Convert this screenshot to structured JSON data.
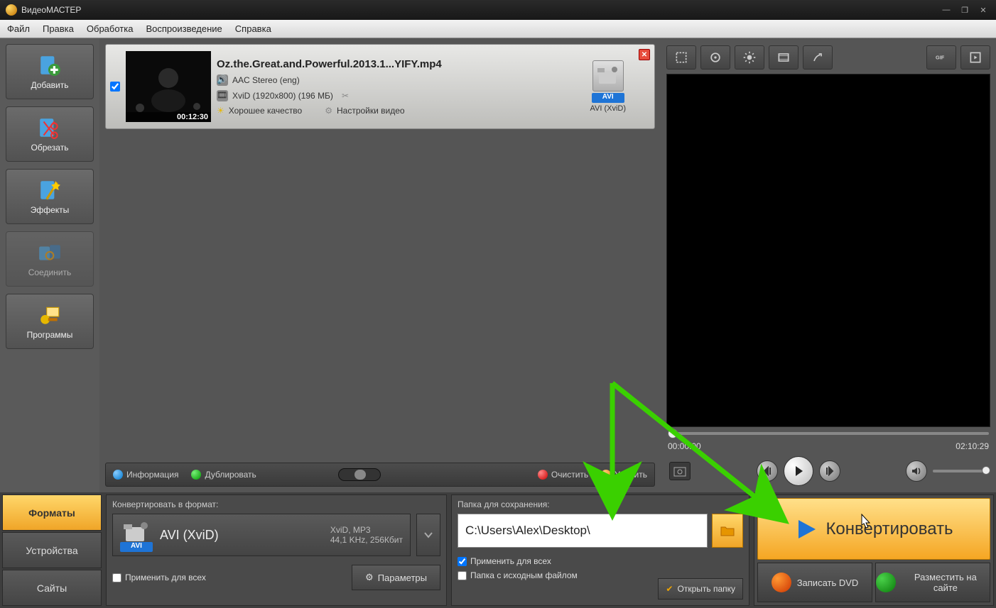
{
  "title": "ВидеоМАСТЕР",
  "menu": [
    "Файл",
    "Правка",
    "Обработка",
    "Воспроизведение",
    "Справка"
  ],
  "sidebar": [
    {
      "label": "Добавить",
      "name": "add-button"
    },
    {
      "label": "Обрезать",
      "name": "cut-button"
    },
    {
      "label": "Эффекты",
      "name": "effects-button"
    },
    {
      "label": "Соединить",
      "name": "join-button",
      "disabled": true
    },
    {
      "label": "Программы",
      "name": "programs-button"
    }
  ],
  "item": {
    "duration": "00:12:30",
    "title": "Oz.the.Great.and.Powerful.2013.1...YIFY.mp4",
    "audio": "AAC Stereo (eng)",
    "video": "XviD (1920x800) (196 МБ)",
    "quality": "Хорошее качество",
    "settings": "Настройки видео",
    "target_badge": "AVI",
    "target_label": "AVI (XviD)"
  },
  "list_toolbar": {
    "info": "Информация",
    "dup": "Дублировать",
    "clear": "Очистить",
    "del": "Удалить"
  },
  "preview": {
    "current": "00:00:00",
    "total": "02:10:29"
  },
  "bottom_tabs": [
    "Форматы",
    "Устройства",
    "Сайты"
  ],
  "format": {
    "heading": "Конвертировать в формат:",
    "name": "AVI (XviD)",
    "line1": "XviD, MP3",
    "line2": "44,1 KHz, 256Кбит",
    "badge": "AVI",
    "apply_all": "Применить для всех",
    "params": "Параметры"
  },
  "folder": {
    "heading": "Папка для сохранения:",
    "path": "C:\\Users\\Alex\\Desktop\\",
    "apply_all": "Применить для всех",
    "same_folder": "Папка с исходным файлом",
    "open": "Открыть папку"
  },
  "actions": {
    "convert": "Конвертировать",
    "dvd": "Записать DVD",
    "site": "Разместить на сайте"
  }
}
